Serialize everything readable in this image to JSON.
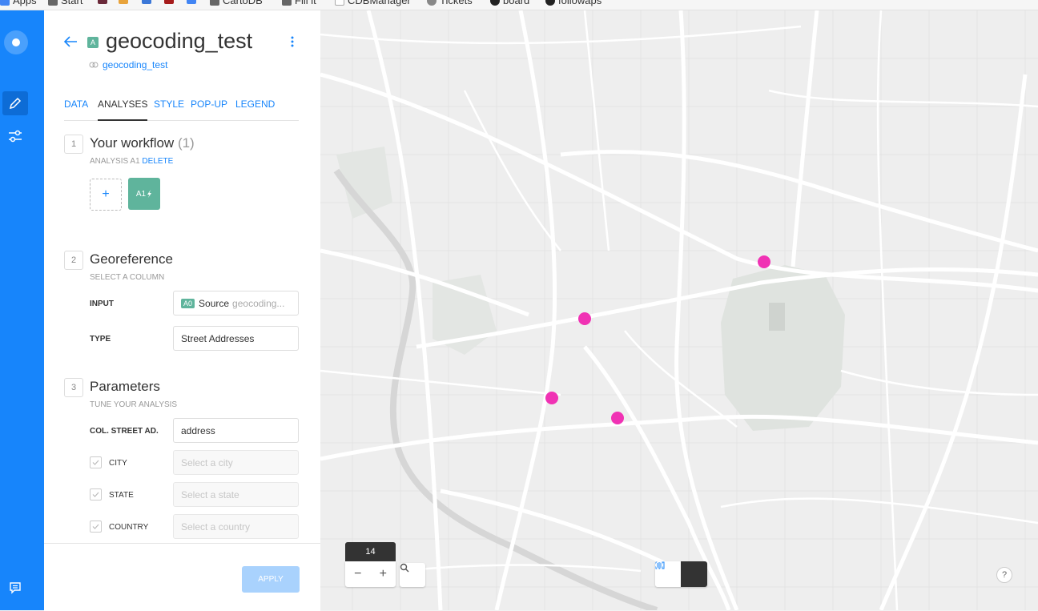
{
  "bookmarks": [
    {
      "label": "Apps",
      "color": "#4285f4"
    },
    {
      "label": "Start",
      "color": "#666666"
    },
    {
      "label": "",
      "color": "#6b2a3a"
    },
    {
      "label": "",
      "color": "#e8a33b"
    },
    {
      "label": "",
      "color": "#3c78d8"
    },
    {
      "label": "",
      "color": "#a61c1c"
    },
    {
      "label": "",
      "color": "#4285f4"
    },
    {
      "label": "CartoDB",
      "color": "#666666"
    },
    {
      "label": "Fill it",
      "color": "#666666"
    },
    {
      "label": "CDBManager",
      "color": "#ffffff"
    },
    {
      "label": "Tickets",
      "color": "#888888"
    },
    {
      "label": "board",
      "color": "#222222"
    },
    {
      "label": "followaps",
      "color": "#222222"
    }
  ],
  "rail": {
    "logo_icon": "carto-logo-icon",
    "items": [
      {
        "icon": "pencil-icon",
        "active": true
      },
      {
        "icon": "sliders-icon",
        "active": false
      }
    ],
    "bottom_icon": "chat-icon"
  },
  "header": {
    "badge": "A",
    "title": "geocoding_test",
    "source_link": "geocoding_test"
  },
  "tabs": [
    {
      "label": "DATA",
      "active": false
    },
    {
      "label": "ANALYSES",
      "active": true
    },
    {
      "label": "STYLE",
      "active": false
    },
    {
      "label": "POP-UP",
      "active": false
    },
    {
      "label": "LEGEND",
      "active": false
    }
  ],
  "workflow": {
    "num": "1",
    "title": "Your workflow",
    "count": "(1)",
    "sub": "ANALYSIS A1",
    "delete": "DELETE",
    "add": "+",
    "node": "A1"
  },
  "georef": {
    "num": "2",
    "title": "Georeference",
    "sub": "SELECT A COLUMN",
    "input_label": "INPUT",
    "input_badge": "A0",
    "input_source": "Source",
    "input_name": "geocoding...",
    "type_label": "TYPE",
    "type_value": "Street Addresses"
  },
  "params": {
    "num": "3",
    "title": "Parameters",
    "sub": "TUNE YOUR ANALYSIS",
    "street_label": "COL. STREET AD.",
    "street_value": "address",
    "city_label": "CITY",
    "city_placeholder": "Select a city",
    "state_label": "STATE",
    "state_placeholder": "Select a state",
    "country_label": "COUNTRY",
    "country_placeholder": "Select a country"
  },
  "footer": {
    "apply": "APPLY"
  },
  "map": {
    "zoom": "14",
    "zoom_out": "−",
    "zoom_in": "+",
    "help": "?",
    "point_color": "#f032b4"
  }
}
